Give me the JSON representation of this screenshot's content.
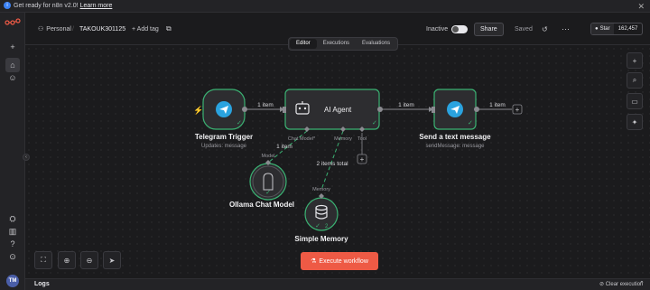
{
  "banner": {
    "text": "Get ready for n8n v2.0!",
    "link": "Learn more"
  },
  "header": {
    "project": "Personal",
    "workflow_name": "TAKOUK301125",
    "add_tag": "+ Add tag",
    "status_label": "Inactive",
    "share": "Share",
    "saved": "Saved",
    "github_star": "Star",
    "github_count": "162,457"
  },
  "tabs": [
    "Editor",
    "Executions",
    "Evaluations"
  ],
  "nodes": {
    "telegram_trigger": {
      "title": "Telegram Trigger",
      "subtitle": "Updates: message"
    },
    "ai_agent": {
      "title": "AI Agent"
    },
    "send_message": {
      "title": "Send a text message",
      "subtitle": "sendMessage: message"
    },
    "ollama": {
      "title": "Ollama Chat Model"
    },
    "memory": {
      "title": "Simple Memory",
      "count": "2"
    }
  },
  "ports": {
    "chat_model": "Chat Model*",
    "memory": "Memory",
    "tool": "Tool",
    "model": "Model",
    "memory_in": "Memory"
  },
  "connections": {
    "trigger_to_agent": "1 item",
    "agent_to_send": "1 item",
    "send_out": "1 item",
    "model_link": "1 item",
    "memory_link": "2 items total"
  },
  "toolbar": {
    "execute": "Execute workflow"
  },
  "logs": {
    "title": "Logs",
    "clear": "Clear execution"
  },
  "colors": {
    "accent": "#ee5a45",
    "success": "#3bb273",
    "telegram": "#2aa3df"
  }
}
